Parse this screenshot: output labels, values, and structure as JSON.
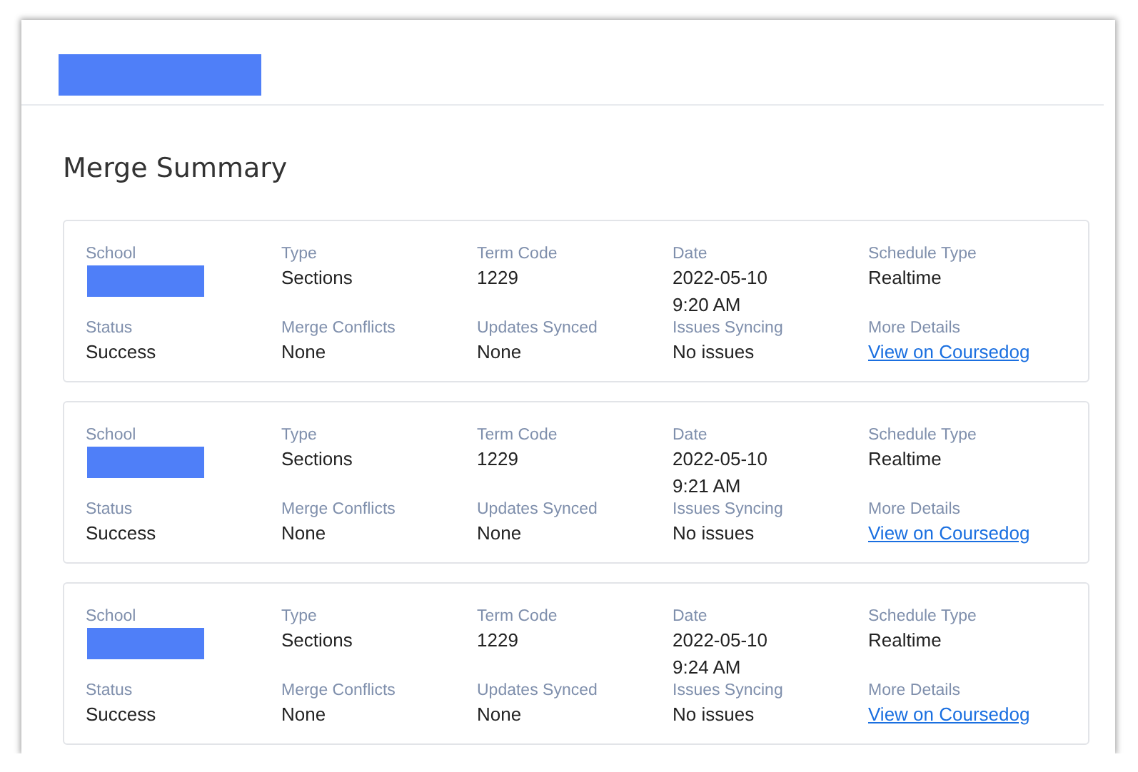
{
  "header": {
    "redacted": true
  },
  "title": "Merge Summary",
  "merges": [
    {
      "fields": [
        {
          "label": "School",
          "kind": "redacted"
        },
        {
          "label": "Type",
          "kind": "text",
          "value": "Sections"
        },
        {
          "label": "Term Code",
          "kind": "text",
          "value": "1229"
        },
        {
          "label": "Date",
          "kind": "datetime",
          "value": "2022-05-10 9:20 AM"
        },
        {
          "label": "Schedule Type",
          "kind": "text",
          "value": "Realtime"
        },
        {
          "label": "Status",
          "kind": "text",
          "value": "Success"
        },
        {
          "label": "Merge Conflicts",
          "kind": "text",
          "value": "None"
        },
        {
          "label": "Updates Synced",
          "kind": "text",
          "value": "None"
        },
        {
          "label": "Issues Syncing",
          "kind": "text",
          "value": "No issues"
        },
        {
          "label": "More Details",
          "kind": "link",
          "value": "View on Coursedog"
        }
      ]
    },
    {
      "fields": [
        {
          "label": "School",
          "kind": "redacted"
        },
        {
          "label": "Type",
          "kind": "text",
          "value": "Sections"
        },
        {
          "label": "Term Code",
          "kind": "text",
          "value": "1229"
        },
        {
          "label": "Date",
          "kind": "datetime",
          "value": "2022-05-10 9:21 AM"
        },
        {
          "label": "Schedule Type",
          "kind": "text",
          "value": "Realtime"
        },
        {
          "label": "Status",
          "kind": "text",
          "value": "Success"
        },
        {
          "label": "Merge Conflicts",
          "kind": "text",
          "value": "None"
        },
        {
          "label": "Updates Synced",
          "kind": "text",
          "value": "None"
        },
        {
          "label": "Issues Syncing",
          "kind": "text",
          "value": "No issues"
        },
        {
          "label": "More Details",
          "kind": "link",
          "value": "View on Coursedog"
        }
      ]
    },
    {
      "fields": [
        {
          "label": "School",
          "kind": "redacted"
        },
        {
          "label": "Type",
          "kind": "text",
          "value": "Sections"
        },
        {
          "label": "Term Code",
          "kind": "text",
          "value": "1229"
        },
        {
          "label": "Date",
          "kind": "datetime",
          "value": "2022-05-10 9:24 AM"
        },
        {
          "label": "Schedule Type",
          "kind": "text",
          "value": "Realtime"
        },
        {
          "label": "Status",
          "kind": "text",
          "value": "Success"
        },
        {
          "label": "Merge Conflicts",
          "kind": "text",
          "value": "None"
        },
        {
          "label": "Updates Synced",
          "kind": "text",
          "value": "None"
        },
        {
          "label": "Issues Syncing",
          "kind": "text",
          "value": "No issues"
        },
        {
          "label": "More Details",
          "kind": "link",
          "value": "View on Coursedog"
        }
      ]
    }
  ]
}
